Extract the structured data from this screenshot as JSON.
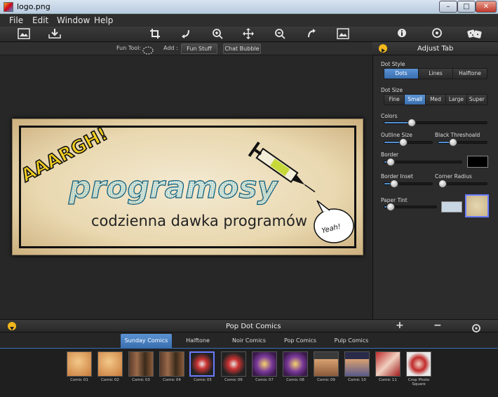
{
  "window": {
    "title": "logo.png",
    "min": "–",
    "max": "□",
    "close": "✕"
  },
  "menu": [
    "File",
    "Edit",
    "Window",
    "Help"
  ],
  "funbar": {
    "fun_tool_label": "Fun Tool:",
    "add_label": "Add :",
    "fun_stuff": "Fun Stuff",
    "chat_bubble": "Chat Bubble"
  },
  "banner": {
    "exclaim": "AAARGH!",
    "title": "programosy",
    "subtitle": "codzienna dawka programów",
    "bubble": "Yeah!"
  },
  "panel": {
    "title": "Adjust Tab",
    "dot_style": {
      "label": "Dot Style",
      "options": [
        "Dots",
        "Lines",
        "Halftone"
      ],
      "selected": "Dots"
    },
    "dot_size": {
      "label": "Dot Size",
      "options": [
        "Fine",
        "Small",
        "Med",
        "Large",
        "Super"
      ],
      "selected": "Small"
    },
    "colors": {
      "label": "Colors",
      "value": 0.27
    },
    "outline_size": {
      "label": "Outline Size",
      "value": 0.4
    },
    "black_threshold": {
      "label": "Black Threshoald",
      "value": 0.3
    },
    "border": {
      "label": "Border",
      "value": 0.08
    },
    "border_inset": {
      "label": "Border Inset",
      "value": 0.2
    },
    "corner_radius": {
      "label": "Corner Radius",
      "value": 0.05
    },
    "paper_tint": {
      "label": "Paper Tint",
      "value": 0.12
    }
  },
  "bottom": {
    "title": "Pop Dot Comics",
    "add": "+",
    "remove": "−",
    "tabs": [
      "Sunday Comics",
      "Halftone",
      "Noir Comics",
      "Pop Comics",
      "Pulp Comics"
    ],
    "selected_tab": "Sunday Comics",
    "thumbs": [
      "Comic 01",
      "Comic 02",
      "Comic 03",
      "Comic 04",
      "Comic 05",
      "Comic 06",
      "Comic 07",
      "Comic 08",
      "Comic 09",
      "Comic 10",
      "Comic 11",
      "Crop Photo Square"
    ],
    "selected_thumb": "Comic 05"
  },
  "colors": {
    "accent": "#3a6fb0",
    "border_swatch": "#000000",
    "tint_swatch": "#c9d6e3",
    "paper_swatch": "#d8c8a0"
  }
}
